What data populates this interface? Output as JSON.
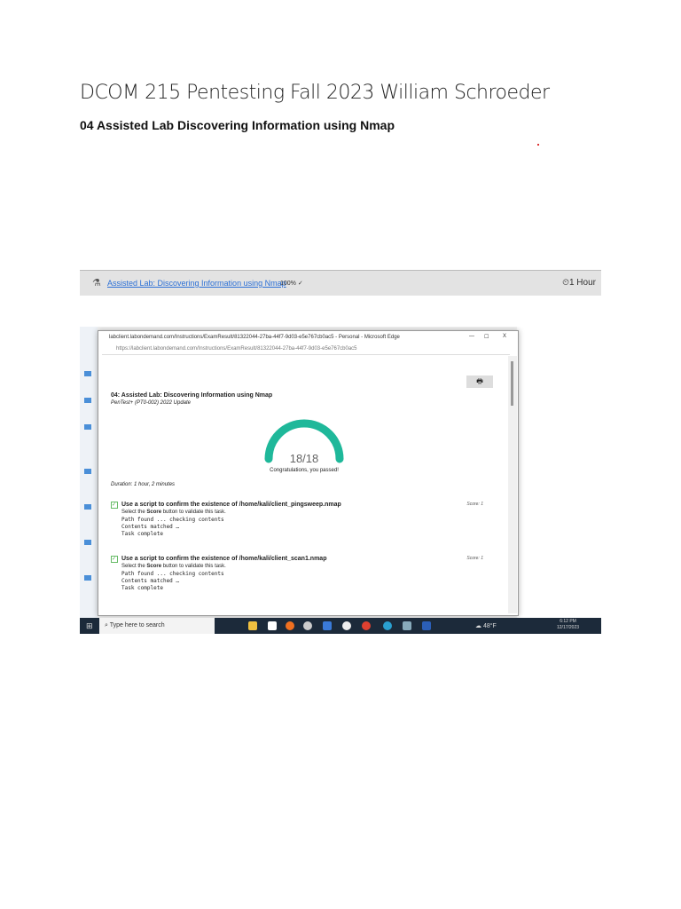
{
  "document": {
    "title": "DCOM 215 Pentesting Fall 2023 William Schroeder",
    "subtitle": "04 Assisted Lab Discovering Information using Nmap"
  },
  "banner": {
    "link": "Assisted Lab: Discovering Information using Nmap",
    "percent": "100%",
    "check": "✓",
    "duration": "⏲1 Hour"
  },
  "browser": {
    "window_title": "labclient.labondemand.com/Instructions/ExamResult/81322044-27ba-44f7-9d03-e5e767cb0ac5 - Personal - Microsoft Edge",
    "url": "https://labclient.labondemand.com/Instructions/ExamResult/81322044-27ba-44f7-9d03-e5e767cb0ac5",
    "min": "—",
    "max": "☐",
    "close": "X"
  },
  "result": {
    "title": "04: Assisted Lab: Discovering Information using Nmap",
    "course": "PenTest+ (PT0-002) 2022 Update",
    "score": "18/18",
    "score_fraction": 1.0,
    "message": "Congratulations, you passed!",
    "duration": "Duration: 1 hour, 2 minutes",
    "tasks": [
      {
        "title": "Use a script to confirm the existence of /home/kali/client_pingsweep.nmap",
        "score": "Score: 1",
        "instr_pre": "Select the ",
        "instr_bold": "Score",
        "instr_post": " button to validate this task.",
        "out1": "Path found ... checking contents",
        "out2": "Contents matched …",
        "out3": "Task complete"
      },
      {
        "title": "Use a script to confirm the existence of /home/kali/client_scan1.nmap",
        "score": "Score: 1",
        "instr_pre": "Select the ",
        "instr_bold": "Score",
        "instr_post": " button to validate this task.",
        "out1": "Path found ... checking contents",
        "out2": "Contents matched …",
        "out3": "Task complete"
      }
    ]
  },
  "taskbar": {
    "search": "Type here to search",
    "weather": "48°F",
    "time": "6:12 PM",
    "date": "12/17/2023"
  },
  "colors": {
    "gauge": "#1fb89a",
    "link": "#2a6fd6"
  }
}
